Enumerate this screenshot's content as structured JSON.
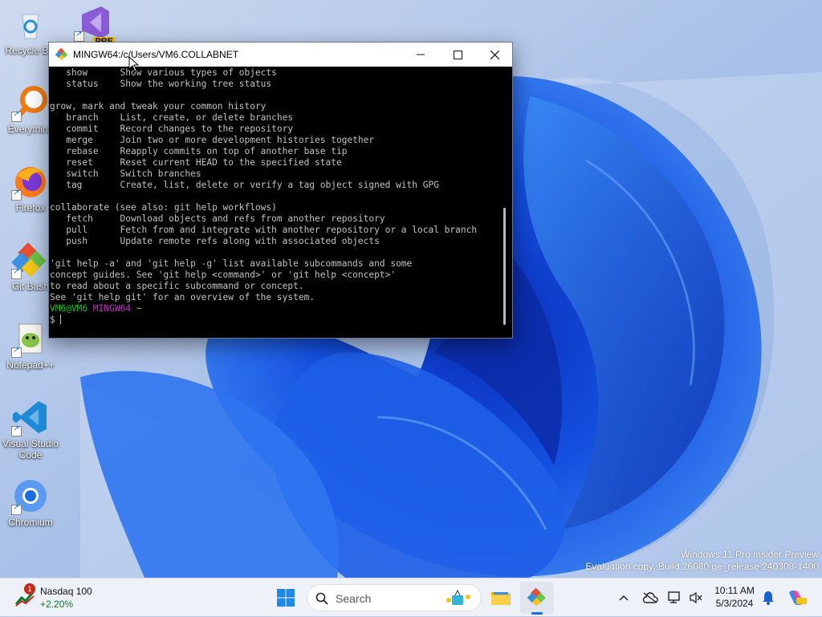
{
  "desktop": {
    "icons": [
      {
        "label": "Recycle Bin",
        "icon": "recycle-bin-icon"
      },
      {
        "label": "Everything",
        "icon": "everything-search-icon"
      },
      {
        "label": "Firefox",
        "icon": "firefox-icon"
      },
      {
        "label": "Git Bash",
        "icon": "git-bash-icon"
      },
      {
        "label": "Notepad++",
        "icon": "notepadpp-icon"
      },
      {
        "label": "Visual Studio Code",
        "icon": "vscode-icon"
      },
      {
        "label": "Chromium",
        "icon": "chromium-icon"
      }
    ],
    "vs_preview_badge": "PRE"
  },
  "terminal": {
    "title": "MINGW64:/c/Users/VM6.COLLABNET",
    "lines": [
      "   show      Show various types of objects",
      "   status    Show the working tree status",
      "",
      "grow, mark and tweak your common history",
      "   branch    List, create, or delete branches",
      "   commit    Record changes to the repository",
      "   merge     Join two or more development histories together",
      "   rebase    Reapply commits on top of another base tip",
      "   reset     Reset current HEAD to the specified state",
      "   switch    Switch branches",
      "   tag       Create, list, delete or verify a tag object signed with GPG",
      "",
      "collaborate (see also: git help workflows)",
      "   fetch     Download objects and refs from another repository",
      "   pull      Fetch from and integrate with another repository or a local branch",
      "   push      Update remote refs along with associated objects",
      "",
      "'git help -a' and 'git help -g' list available subcommands and some",
      "concept guides. See 'git help <command>' or 'git help <concept>'",
      "to read about a specific subcommand or concept.",
      "See 'git help git' for an overview of the system.",
      ""
    ],
    "prompt_user": "VM6@VM6",
    "prompt_env": "MINGW64",
    "prompt_path": "~",
    "prompt_symbol": "$ "
  },
  "watermark": {
    "line1": "Windows 11 Pro Insider Preview",
    "line2": "Evaluation copy. Build 26080.ge_release.240308-1400"
  },
  "taskbar": {
    "widget": {
      "name": "Nasdaq 100",
      "change": "+2.20%",
      "badge": "1"
    },
    "search_placeholder": "Search",
    "clock": {
      "time": "10:11 AM",
      "date": "5/3/2024"
    }
  },
  "colors": {
    "prompt_user": "#19c219",
    "prompt_env": "#c230c2",
    "prompt_path": "#c8c81a",
    "accent": "#1a6fd6"
  }
}
